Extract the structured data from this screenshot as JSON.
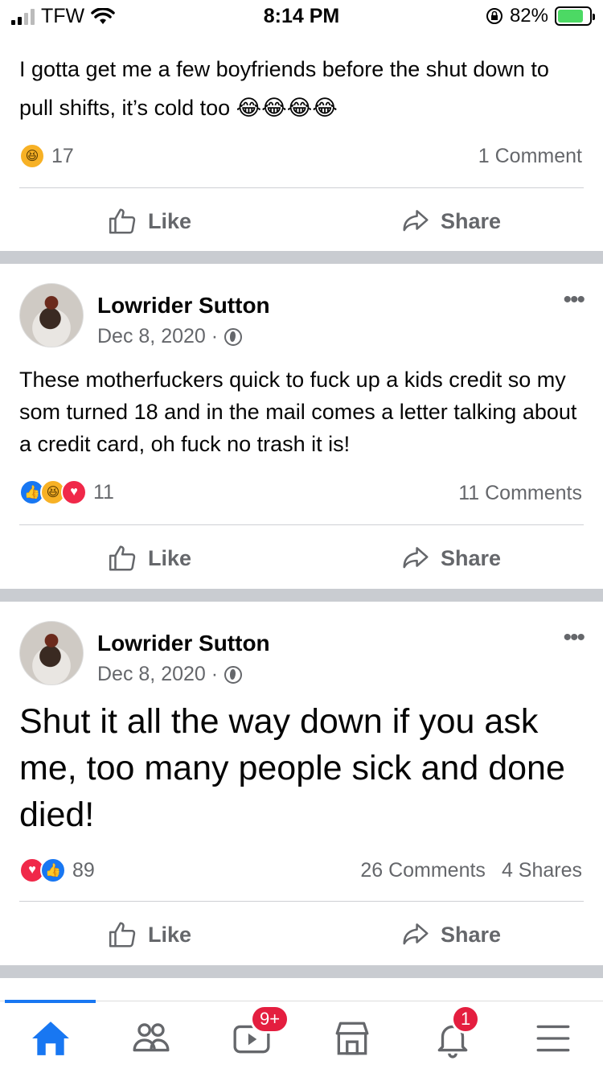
{
  "status_bar": {
    "carrier": "TFW",
    "time": "8:14 PM",
    "battery": "82%"
  },
  "post_top": {
    "text": "I gotta get me a few boyfriends before the shut down to pull shifts, it’s cold too 😂😂😂😂",
    "reaction_count": "17",
    "comments": "1 Comment"
  },
  "post_1": {
    "author": "Lowrider Sutton",
    "date": "Dec 8, 2020 ·",
    "text": "These motherfuckers quick to fuck up a kids credit so my som turned 18 and in the mail comes a letter talking about a credit card, oh fuck no trash it is!",
    "reaction_count": "11",
    "comments": "11 Comments"
  },
  "post_2": {
    "author": "Lowrider Sutton",
    "date": "Dec 8, 2020 ·",
    "text": "Shut it all the way down if you ask me, too many people sick and done died!",
    "reaction_count": "89",
    "comments": "26 Comments",
    "shares": "4 Shares"
  },
  "actions": {
    "like": "Like",
    "share": "Share"
  },
  "nav": {
    "video_badge": "9+",
    "notifications_badge": "1"
  },
  "colors": {
    "accent": "#1877f2",
    "badge": "#e41e3f",
    "separator": "#c9ccd1"
  }
}
